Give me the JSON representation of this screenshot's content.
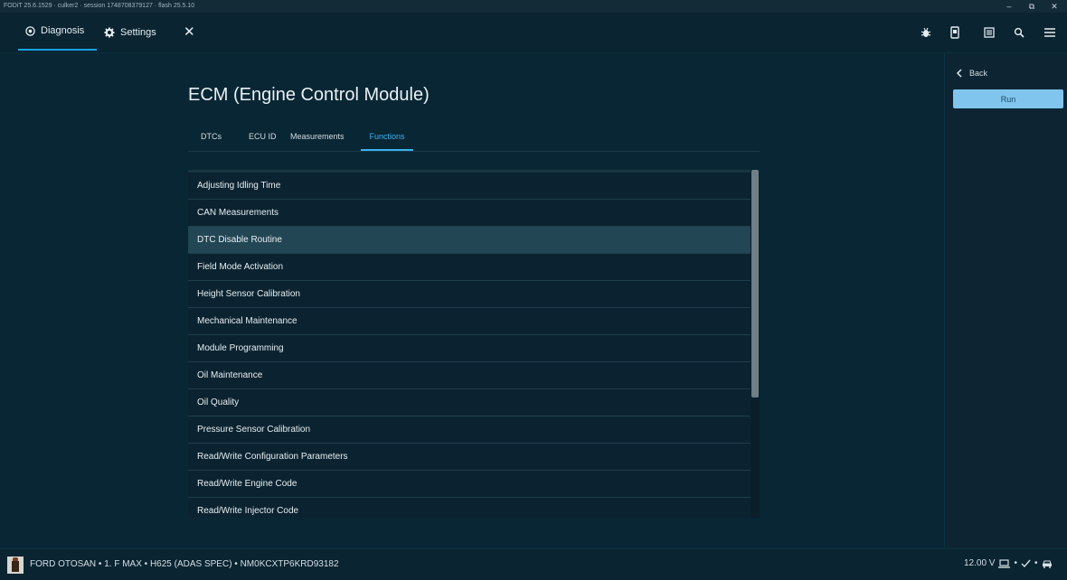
{
  "window": {
    "title": "FODiT 25.6.1529 · culker2 · session 1748708379127 · flash 25.5.10",
    "controls": [
      "–",
      "⧉",
      "✕"
    ]
  },
  "nav": {
    "tabs": [
      {
        "label": "Diagnosis",
        "icon": "diagnosis-icon",
        "active": true
      },
      {
        "label": "Settings",
        "icon": "gear-icon",
        "active": false
      }
    ],
    "close_label": "✕",
    "right_icons": [
      "bug-icon",
      "device-icon",
      "list-icon",
      "search-icon",
      "menu-icon"
    ]
  },
  "side_panel": {
    "back_label": "Back",
    "run_label": "Run"
  },
  "main": {
    "title": "ECM (Engine Control Module)",
    "tabs": [
      {
        "label": "DTCs"
      },
      {
        "label": "ECU ID"
      },
      {
        "label": "Measurements"
      },
      {
        "label": "Functions",
        "active": true
      }
    ],
    "functions": [
      "Adjusting Idling Time",
      "CAN Measurements",
      "DTC Disable Routine",
      "Field Mode Activation",
      "Height Sensor Calibration",
      "Mechanical Maintenance",
      "Module Programming",
      "Oil Maintenance",
      "Oil Quality",
      "Pressure Sensor Calibration",
      "Read/Write Configuration Parameters",
      "Read/Write Engine Code",
      "Read/Write Injector Code"
    ],
    "selected_function": "DTC Disable Routine"
  },
  "status": {
    "vehicle": "FORD OTOSAN • 1. F MAX • H625 (ADAS SPEC) • NM0KCXTP6KRD93182",
    "voltage": "12.00 V",
    "separator": "•",
    "icons": [
      "laptop-icon",
      "check-icon",
      "car-icon"
    ]
  },
  "colors": {
    "background": "#092634",
    "accent": "#1aa2e6",
    "run_button": "#7fc5ee",
    "selected_row": "#234655"
  }
}
